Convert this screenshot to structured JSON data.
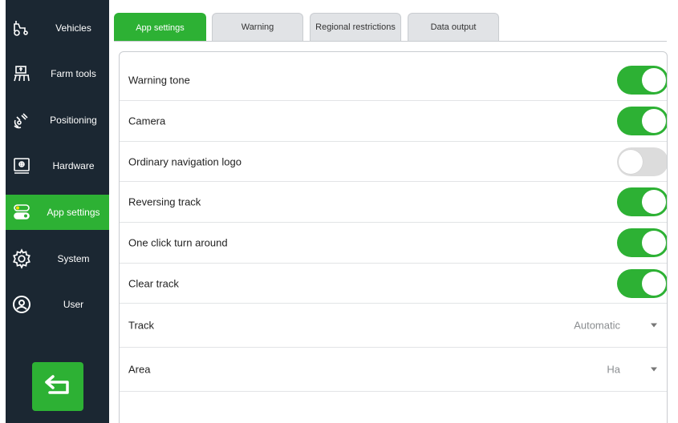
{
  "sidebar": {
    "items": [
      {
        "label": "Vehicles",
        "icon": "tractor-icon",
        "active": false
      },
      {
        "label": "Farm tools",
        "icon": "implement-icon",
        "active": false
      },
      {
        "label": "Positioning",
        "icon": "satellite-icon",
        "active": false
      },
      {
        "label": "Hardware",
        "icon": "display-device-icon",
        "active": false
      },
      {
        "label": "App settings",
        "icon": "toggle-switch-icon",
        "active": true
      },
      {
        "label": "System",
        "icon": "gear-icon",
        "active": false
      },
      {
        "label": "User",
        "icon": "user-icon",
        "active": false
      }
    ],
    "back_icon": "back-arrow-icon"
  },
  "tabs": [
    {
      "label": "App settings",
      "active": true
    },
    {
      "label": "Warning",
      "active": false
    },
    {
      "label": "Regional restrictions",
      "active": false
    },
    {
      "label": "Data output",
      "active": false
    }
  ],
  "settings": {
    "toggles": [
      {
        "label": "Warning tone",
        "on": true
      },
      {
        "label": "Camera",
        "on": true
      },
      {
        "label": "Ordinary navigation logo",
        "on": false
      },
      {
        "label": "Reversing track",
        "on": true
      },
      {
        "label": "One click turn around",
        "on": true
      },
      {
        "label": "Clear track",
        "on": true
      }
    ],
    "selects": [
      {
        "label": "Track",
        "value": "Automatic"
      },
      {
        "label": "Area",
        "value": "Ha"
      }
    ]
  },
  "colors": {
    "accent": "#2db134",
    "sidebar_bg": "#1b2732",
    "toggle_off": "#dcdcdc"
  }
}
